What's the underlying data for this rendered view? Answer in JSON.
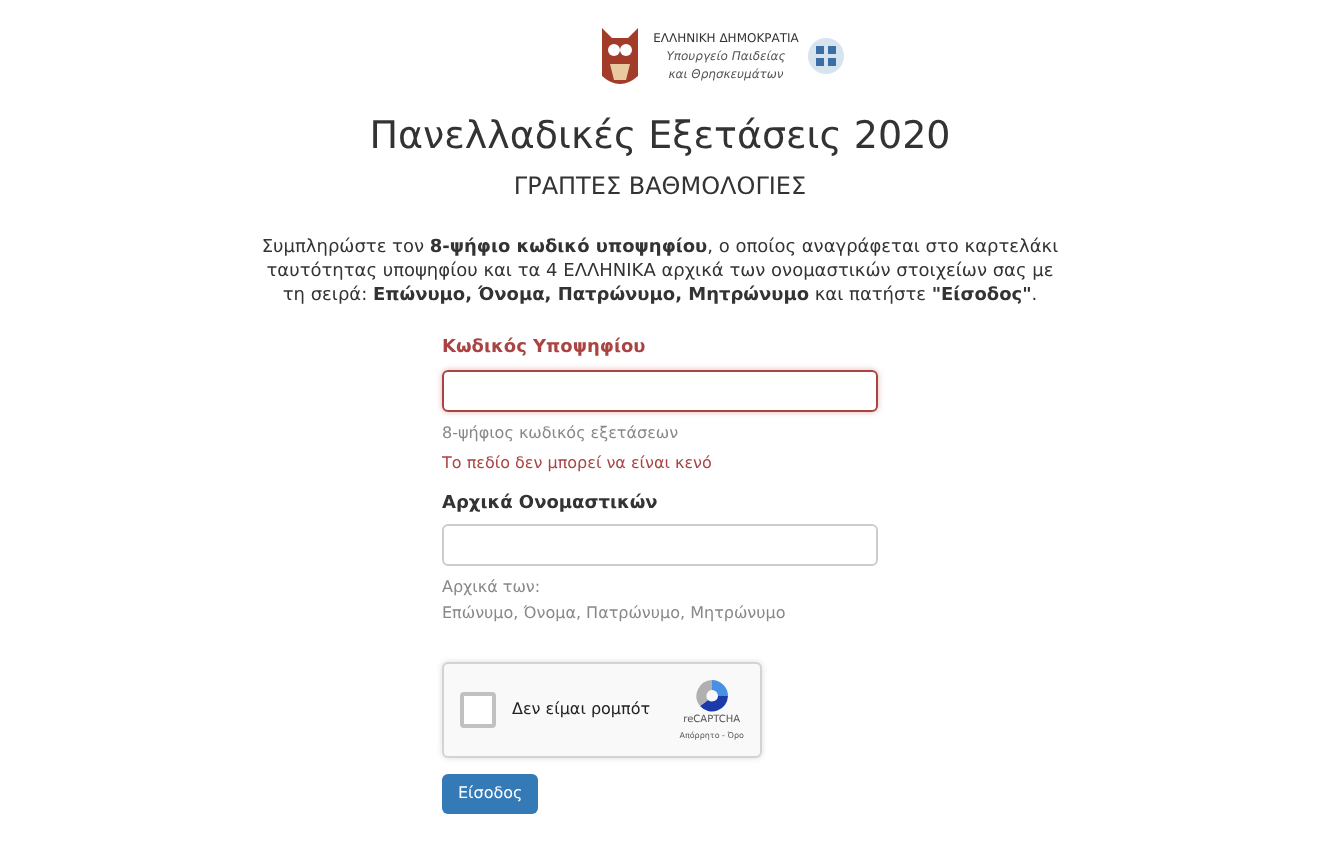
{
  "logo": {
    "lines": [
      "ΕΛΛΗΝΙΚΗ ΔΗΜΟΚΡΑΤΙΑ",
      "Υπουργείο Παιδείας",
      "και Θρησκευμάτων"
    ]
  },
  "title": "Πανελλαδικές Εξετάσεις 2020",
  "subtitle": "ΓΡΑΠΤΕΣ ΒΑΘΜΟΛΟΓΙΕΣ",
  "instructions": "Συμπληρώστε τον **8-ψήφιο κωδικό υποψηφίου**, ο οποίος αναγράφεται στο καρτελάκι ταυτότητας υποψηφίου και τα 4 ΕΛΛΗΝΙΚΑ αρχικά των ονομαστικών στοιχείων σας με τη σειρά: **Επώνυμο, Όνομα, Πατρώνυμο, Μητρώνυμο** και πατήστε **\"Είσοδος\"**.",
  "fields": [
    {
      "label": "Κωδικός Υποψηφίου",
      "error": true,
      "help": [
        "8-ψήφιος κωδικός εξετάσεων"
      ],
      "error_message": "Το πεδίο δεν μπορεί να είναι κενό"
    },
    {
      "label": "Αρχικά Ονομαστικών",
      "error": false,
      "help": [
        "Αρχικά των:",
        "Επώνυμο, Όνομα, Πατρώνυμο, Μητρώνυμο"
      ]
    }
  ],
  "captcha": {
    "label": "Δεν είμαι ρομπότ",
    "checked": false,
    "brand": "reCAPTCHA",
    "links": "Απόρρητο - Όρο"
  },
  "submit": "Είσοδος"
}
